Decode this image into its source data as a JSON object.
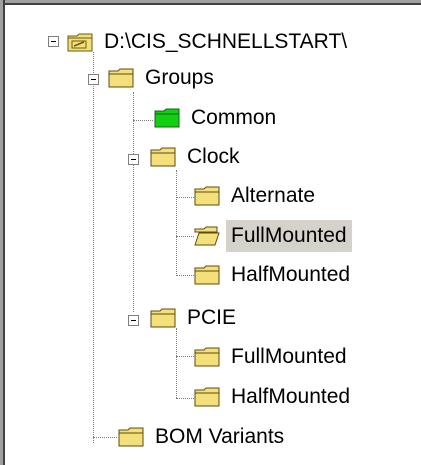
{
  "tree": {
    "root": {
      "label": "D:\\CIS_SCHNELLSTART\\"
    },
    "groups": {
      "label": "Groups"
    },
    "common": {
      "label": "Common"
    },
    "clock": {
      "label": "Clock"
    },
    "alternate": {
      "label": "Alternate"
    },
    "clock_full": {
      "label": "FullMounted"
    },
    "clock_half": {
      "label": "HalfMounted"
    },
    "pcie": {
      "label": "PCIE"
    },
    "pcie_full": {
      "label": "FullMounted"
    },
    "pcie_half": {
      "label": "HalfMounted"
    },
    "bom": {
      "label": "BOM Variants"
    }
  },
  "colors": {
    "folder_yellow": "#f4e07a",
    "folder_green": "#11d011",
    "selection": "#d5d1cb"
  },
  "icons": {
    "root": "folder-with-check-icon",
    "common": "green-folder-icon",
    "clock_full": "open-folder-icon",
    "default": "folder-icon"
  }
}
